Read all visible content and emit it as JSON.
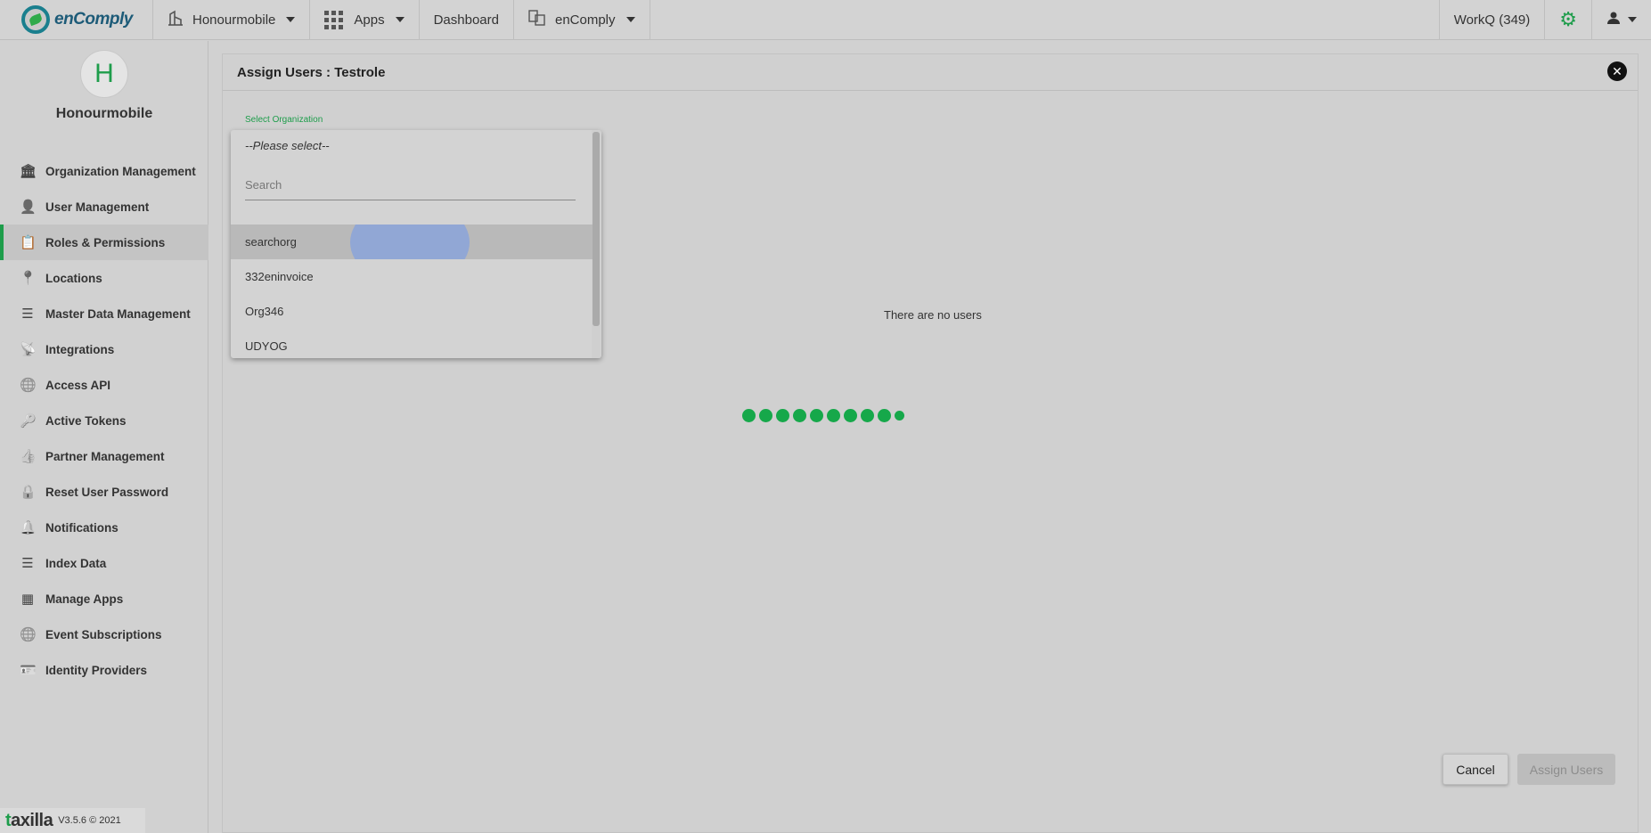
{
  "header": {
    "logo_text": "enComply",
    "org_selector": "Honourmobile",
    "apps_label": "Apps",
    "dashboard_label": "Dashboard",
    "app_selector": "enComply",
    "workq_label": "WorkQ (349)"
  },
  "sidebar": {
    "avatar_letter": "H",
    "org_name": "Honourmobile",
    "items": [
      {
        "label": "Organization Management",
        "icon": "bank-icon"
      },
      {
        "label": "User Management",
        "icon": "person-icon"
      },
      {
        "label": "Roles & Permissions",
        "icon": "clipboard-icon",
        "active": true
      },
      {
        "label": "Locations",
        "icon": "location-pin-icon"
      },
      {
        "label": "Master Data Management",
        "icon": "list-icon"
      },
      {
        "label": "Integrations",
        "icon": "broadcast-icon"
      },
      {
        "label": "Access API",
        "icon": "globe-icon"
      },
      {
        "label": "Active Tokens",
        "icon": "key-icon"
      },
      {
        "label": "Partner Management",
        "icon": "thumbs-up-icon"
      },
      {
        "label": "Reset User Password",
        "icon": "lock-icon"
      },
      {
        "label": "Notifications",
        "icon": "bell-icon"
      },
      {
        "label": "Index Data",
        "icon": "list-icon"
      },
      {
        "label": "Manage Apps",
        "icon": "apps-grid-icon"
      },
      {
        "label": "Event Subscriptions",
        "icon": "globe-icon"
      },
      {
        "label": "Identity Providers",
        "icon": "id-badge-icon"
      }
    ],
    "footer_brand": "taxilla",
    "version": "V3.5.6 © 2021"
  },
  "panel": {
    "title": "Assign Users : Testrole",
    "select_label": "Select Organization",
    "empty_message": "There are no users",
    "cancel_label": "Cancel",
    "assign_label": "Assign Users"
  },
  "dropdown": {
    "placeholder": "--Please select--",
    "search_placeholder": "Search",
    "options": [
      "searchorg",
      "332eninvoice",
      "Org346",
      "UDYOG"
    ],
    "highlighted_index": 0
  },
  "colors": {
    "accent": "#1e9d4b",
    "loader": "#16a84a",
    "ripple": "#8aa3d9"
  }
}
